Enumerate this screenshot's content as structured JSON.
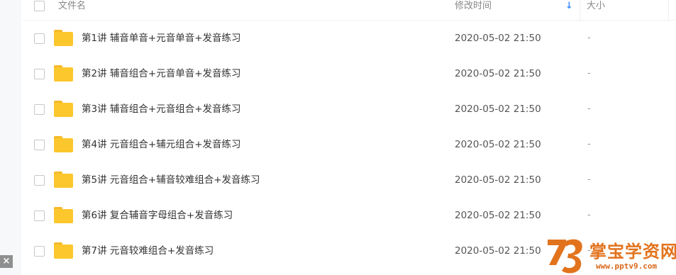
{
  "header": {
    "col_name": "文件名",
    "col_modified": "修改时间",
    "sort_arrow": "↓",
    "col_size": "大小"
  },
  "files": [
    {
      "name": "第1讲 辅音单音+元音单音+发音练习",
      "modified": "2020-05-02 21:50",
      "size": "-"
    },
    {
      "name": "第2讲 辅音组合+元音单音+发音练习",
      "modified": "2020-05-02 21:50",
      "size": "-"
    },
    {
      "name": "第3讲 辅音组合+元音组合+发音练习",
      "modified": "2020-05-02 21:50",
      "size": "-"
    },
    {
      "name": "第4讲 元音组合+辅元组合+发音练习",
      "modified": "2020-05-02 21:50",
      "size": "-"
    },
    {
      "name": "第5讲 元音组合+辅音较难组合+发音练习",
      "modified": "2020-05-02 21:50",
      "size": "-"
    },
    {
      "name": "第6讲 复合辅音字母组合+发音练习",
      "modified": "2020-05-02 21:50",
      "size": "-"
    },
    {
      "name": "第7讲 元音较难组合+发音练习",
      "modified": "2020-05-02 21:50",
      "size": "-"
    }
  ],
  "close_glyph": "×",
  "watermark": {
    "title": "掌宝学资网",
    "url": "www.pptv9.com"
  },
  "colors": {
    "folder": "#fcc72d",
    "sort_arrow": "#3b8cff",
    "watermark": "#e2731d"
  }
}
